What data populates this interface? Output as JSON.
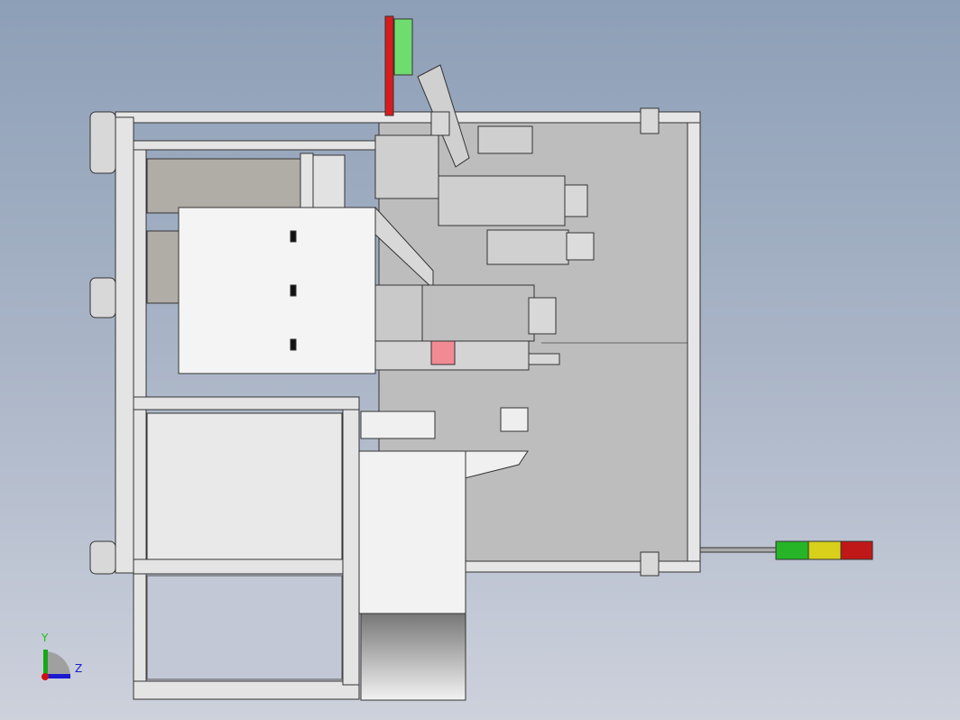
{
  "viewport": {
    "triad": {
      "y_label": "Y",
      "z_label": "Z"
    },
    "colors": {
      "frame": "#e4e4e4",
      "frame_edge": "#3a3a3a",
      "back_plate": "#bcbcbc",
      "panel_white": "#f4f4f4",
      "flag_red": "#d81c1c",
      "flag_green": "#6fdc6f",
      "pink_block": "#f28a94",
      "light_green": "#26b526",
      "light_yellow": "#d8d01a",
      "light_red": "#c01818",
      "axis_y": "#1aa61a",
      "axis_z": "#1a1ad0"
    }
  }
}
